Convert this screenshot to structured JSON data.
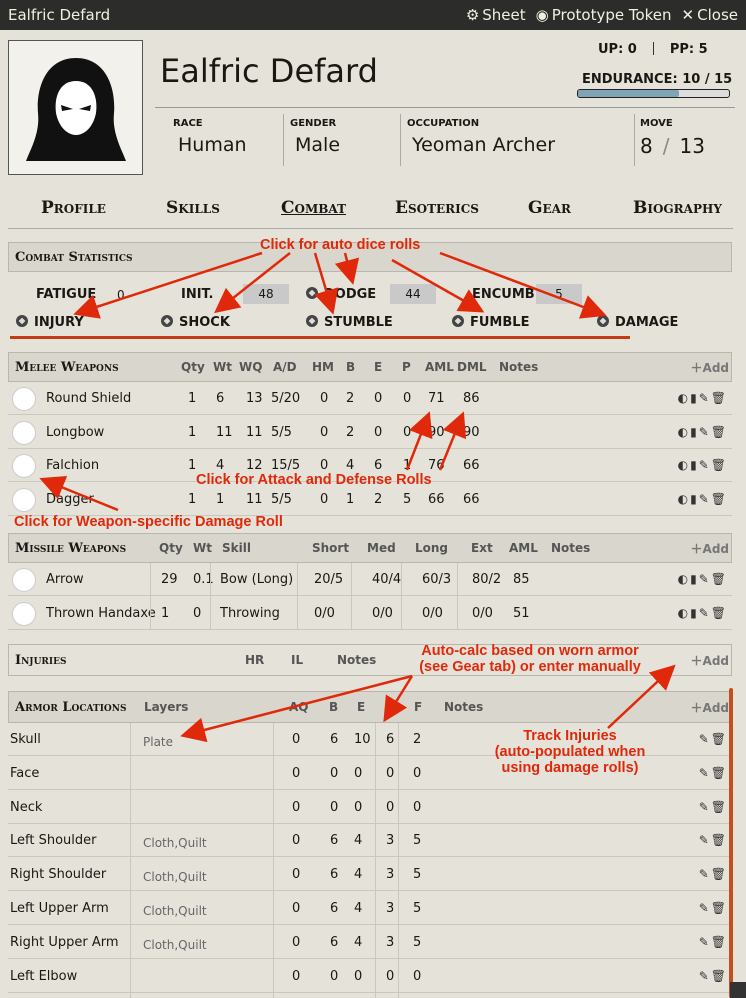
{
  "window": {
    "title": "Ealfric Defard",
    "sheet": "Sheet",
    "prototype": "Prototype Token",
    "close": "Close"
  },
  "header": {
    "name": "Ealfric Defard",
    "up": "UP: 0",
    "pp": "PP: 5",
    "endurance": "ENDURANCE: 10 / 15",
    "endurance_fraction": 0.67,
    "race_label": "RACE",
    "race": "Human",
    "gender_label": "GENDER",
    "gender": "Male",
    "occupation_label": "OCCUPATION",
    "occupation": "Yeoman Archer",
    "move_label": "MOVE",
    "move_a": "8",
    "move_sep": "/",
    "move_b": "13"
  },
  "tabs": [
    "Profile",
    "Skills",
    "Combat",
    "Esoterics",
    "Gear",
    "Biography"
  ],
  "combat": {
    "title": "Combat Statistics",
    "fatigue_label": "FATIGUE",
    "fatigue": "0",
    "init_label": "INIT.",
    "init": "48",
    "dodge_label": "DODGE",
    "dodge": "44",
    "encumb_label": "ENCUMB.",
    "encumb": "5",
    "injury": "INJURY",
    "shock": "SHOCK",
    "stumble": "STUMBLE",
    "fumble": "FUMBLE",
    "damage": "DAMAGE"
  },
  "melee": {
    "title": "Melee Weapons",
    "add": "Add",
    "cols": [
      "Qty",
      "Wt",
      "WQ",
      "A/D",
      "HM",
      "B",
      "E",
      "P",
      "AML",
      "DML",
      "Notes"
    ],
    "rows": [
      [
        "Round Shield",
        "1",
        "6",
        "13",
        "5/20",
        "0",
        "2",
        "0",
        "0",
        "71",
        "86"
      ],
      [
        "Longbow",
        "1",
        "11",
        "11",
        "5/5",
        "0",
        "2",
        "0",
        "0",
        "90",
        "90"
      ],
      [
        "Falchion",
        "1",
        "4",
        "12",
        "15/5",
        "0",
        "4",
        "6",
        "1",
        "76",
        "66"
      ],
      [
        "Dagger",
        "1",
        "1",
        "11",
        "5/5",
        "0",
        "1",
        "2",
        "5",
        "66",
        "66"
      ]
    ]
  },
  "missile": {
    "title": "Missile Weapons",
    "add": "Add",
    "cols": [
      "Qty",
      "Wt",
      "Skill",
      "Short",
      "Med",
      "Long",
      "Ext",
      "AML",
      "Notes"
    ],
    "rows": [
      [
        "Arrow",
        "29",
        "0.1",
        "Bow (Long)",
        "20/5",
        "40/4",
        "60/3",
        "80/2",
        "85"
      ],
      [
        "Thrown Handaxe",
        "1",
        "0",
        "Throwing",
        "0/0",
        "0/0",
        "0/0",
        "0/0",
        "51"
      ]
    ]
  },
  "injuries": {
    "title": "Injuries",
    "cols": [
      "HR",
      "IL",
      "Notes"
    ],
    "add": "Add"
  },
  "armor": {
    "title": "Armor Locations",
    "add": "Add",
    "cols": [
      "Layers",
      "AQ",
      "B",
      "E",
      "P",
      "F",
      "Notes"
    ],
    "rows": [
      [
        "Skull",
        "Plate",
        "0",
        "6",
        "10",
        "6",
        "2"
      ],
      [
        "Face",
        "",
        "0",
        "0",
        "0",
        "0",
        "0"
      ],
      [
        "Neck",
        "",
        "0",
        "0",
        "0",
        "0",
        "0"
      ],
      [
        "Left Shoulder",
        "Cloth,Quilt",
        "0",
        "6",
        "4",
        "3",
        "5"
      ],
      [
        "Right Shoulder",
        "Cloth,Quilt",
        "0",
        "6",
        "4",
        "3",
        "5"
      ],
      [
        "Left Upper Arm",
        "Cloth,Quilt",
        "0",
        "6",
        "4",
        "3",
        "5"
      ],
      [
        "Right Upper Arm",
        "Cloth,Quilt",
        "0",
        "6",
        "4",
        "3",
        "5"
      ],
      [
        "Left Elbow",
        "",
        "0",
        "0",
        "0",
        "0",
        "0"
      ]
    ]
  },
  "annotations": {
    "auto_dice": "Click for auto dice rolls",
    "attack_defense": "Click for Attack and Defense Rolls",
    "weapon_damage": "Click for Weapon-specific Damage Roll",
    "autocalc_1": "Auto-calc based on worn armor",
    "autocalc_2": "(see Gear tab) or enter manually",
    "track_1": "Track Injuries",
    "track_2": "(auto-populated when",
    "track_3": "using damage rolls)"
  },
  "colors": {
    "annotation": "#e0290a",
    "titlebar": "#2c2c2b",
    "background": "#e5e2da"
  }
}
